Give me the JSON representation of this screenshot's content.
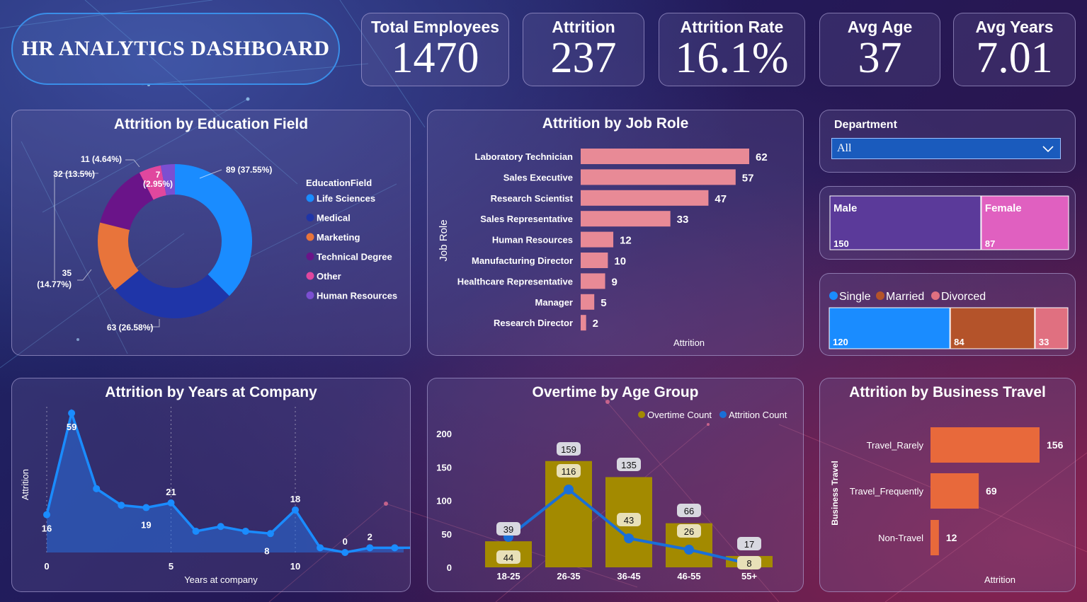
{
  "header": {
    "title": "HR ANALYTICS DASHBOARD"
  },
  "kpis": [
    {
      "label": "Total Employees",
      "value": "1470"
    },
    {
      "label": "Attrition",
      "value": "237"
    },
    {
      "label": "Attrition Rate",
      "value": "16.1%"
    },
    {
      "label": "Avg Age",
      "value": "37"
    },
    {
      "label": "Avg Years",
      "value": "7.01"
    }
  ],
  "colors": {
    "life_sciences": "#1a8cff",
    "medical": "#1f35a8",
    "marketing": "#e8743b",
    "technical_degree": "#6a1489",
    "other": "#e0479e",
    "human_resources": "#7b4fd1",
    "job_role_bar": "#e88a96",
    "line": "#1a8cff",
    "overtime_bar": "#a38a00",
    "travel_bar": "#e8693b",
    "male": "#5b3a9a",
    "female": "#e060c0",
    "single": "#1a8cff",
    "married": "#b4532a",
    "divorced": "#e07080"
  },
  "education_chart": {
    "title": "Attrition by Education Field",
    "legend_title": "EducationField",
    "chart_data": {
      "type": "pie",
      "categories": [
        "Life Sciences",
        "Medical",
        "Marketing",
        "Technical Degree",
        "Other",
        "Human Resources"
      ],
      "values": [
        89,
        63,
        35,
        32,
        11,
        7
      ],
      "labels": [
        "89 (37.55%)",
        "63 (26.58%)",
        "35 (14.77%)",
        "32 (13.5%)",
        "11 (4.64%)",
        "7 (2.95%)"
      ]
    }
  },
  "job_role_chart": {
    "title": "Attrition by Job Role",
    "xlabel": "Attrition",
    "ylabel": "Job Role",
    "chart_data": {
      "type": "bar",
      "categories": [
        "Laboratory Technician",
        "Sales Executive",
        "Research Scientist",
        "Sales Representative",
        "Human Resources",
        "Manufacturing Director",
        "Healthcare Representative",
        "Manager",
        "Research Director"
      ],
      "values": [
        62,
        57,
        47,
        33,
        12,
        10,
        9,
        5,
        2
      ]
    }
  },
  "department_filter": {
    "label": "Department",
    "value": "All"
  },
  "gender": {
    "chart_data": {
      "type": "bar",
      "categories": [
        "Male",
        "Female"
      ],
      "values": [
        150,
        87
      ]
    }
  },
  "marital": {
    "chart_data": {
      "type": "bar",
      "categories": [
        "Single",
        "Married",
        "Divorced"
      ],
      "values": [
        120,
        84,
        33
      ]
    }
  },
  "years_chart": {
    "title": "Attrition by Years at Company",
    "xlabel": "Years at company",
    "ylabel": "Attrition",
    "chart_data": {
      "type": "area",
      "x": [
        0,
        1,
        2,
        3,
        4,
        5,
        6,
        7,
        8,
        9,
        10,
        11,
        12,
        13,
        14,
        15
      ],
      "values": [
        16,
        59,
        27,
        20,
        19,
        21,
        9,
        11,
        9,
        8,
        18,
        2,
        0,
        2,
        2,
        2
      ],
      "point_labels": [
        {
          "x": 0,
          "label": "16"
        },
        {
          "x": 1,
          "label": "59"
        },
        {
          "x": 4,
          "label": "19"
        },
        {
          "x": 5,
          "label": "21"
        },
        {
          "x": 9,
          "label": "8"
        },
        {
          "x": 10,
          "label": "18"
        },
        {
          "x": 12,
          "label": "0"
        },
        {
          "x": 13,
          "label": "2"
        }
      ],
      "xticks": [
        "0",
        "5",
        "10"
      ],
      "ylim": [
        0,
        59
      ]
    }
  },
  "overtime_chart": {
    "title": "Overtime by Age Group",
    "legend": [
      "Overtime Count",
      "Attrition Count"
    ],
    "chart_data": {
      "type": "bar",
      "categories": [
        "18-25",
        "26-35",
        "36-45",
        "46-55",
        "55+"
      ],
      "series": [
        {
          "name": "Overtime Count",
          "values": [
            39,
            159,
            135,
            66,
            17
          ]
        },
        {
          "name": "Attrition Count",
          "values": [
            44,
            116,
            43,
            26,
            8
          ]
        }
      ],
      "yticks": [
        "0",
        "50",
        "100",
        "150",
        "200"
      ],
      "ylim": [
        0,
        200
      ]
    }
  },
  "travel_chart": {
    "title": "Attrition by Business Travel",
    "xlabel": "Attrition",
    "ylabel": "Business Travel",
    "chart_data": {
      "type": "bar",
      "categories": [
        "Travel_Rarely",
        "Travel_Frequently",
        "Non-Travel"
      ],
      "values": [
        156,
        69,
        12
      ]
    }
  }
}
